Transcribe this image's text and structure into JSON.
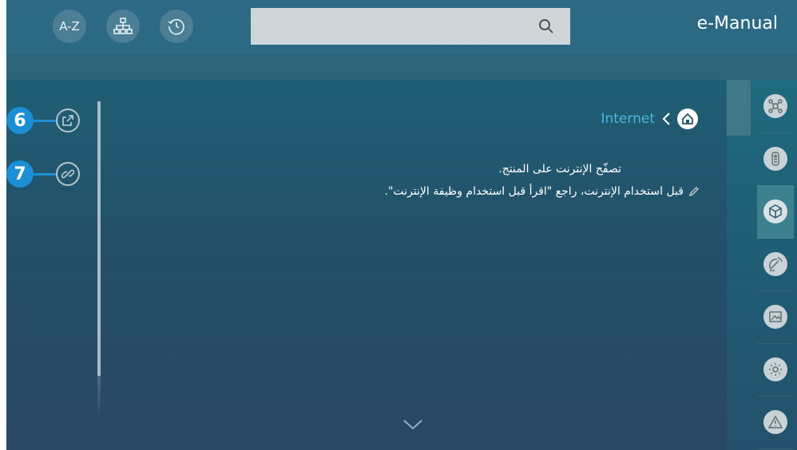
{
  "header": {
    "title": "e-Manual",
    "buttons": [
      {
        "label": "A-Z",
        "icon": "az-icon"
      },
      {
        "label": "",
        "icon": "sitemap-icon"
      },
      {
        "label": "",
        "icon": "history-icon"
      }
    ],
    "search": {
      "value": "",
      "placeholder": ""
    }
  },
  "content": {
    "breadcrumb": "Internet",
    "line1": "تصفّح الإنترنت على المنتج.",
    "note": "قبل استخدام الإنترنت، راجع \"اقرأ قبل استخدام وظيفة الإنترنت\"."
  },
  "callouts": [
    {
      "number": "6",
      "icon": "external-link-icon"
    },
    {
      "number": "7",
      "icon": "link-icon"
    }
  ],
  "rail": {
    "items": [
      {
        "icon": "connections-icon",
        "selected": false
      },
      {
        "icon": "remote-icon",
        "selected": false
      },
      {
        "icon": "smart-features-icon",
        "selected": true
      },
      {
        "icon": "broadcast-icon",
        "selected": false
      },
      {
        "icon": "picture-sound-icon",
        "selected": false
      },
      {
        "icon": "settings-icon",
        "selected": false
      },
      {
        "icon": "warning-icon",
        "selected": false
      }
    ]
  },
  "colors": {
    "accent": "#49b9de",
    "badge": "#1b8fd6",
    "topbar": "#2e6a86"
  }
}
